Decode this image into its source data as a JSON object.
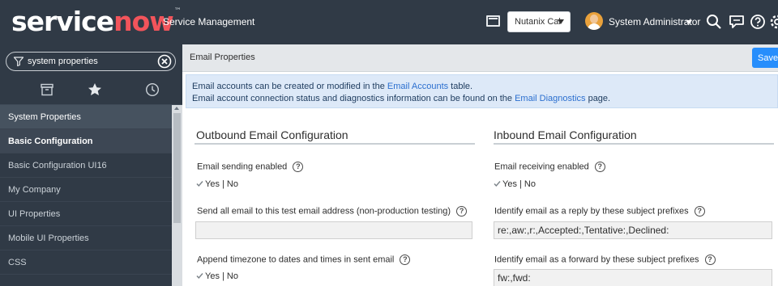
{
  "banner": {
    "logo_service": "service",
    "logo_now": "now",
    "logo_tm": "™",
    "app_name": "Service Management",
    "domain_select": "Nutanix Cal",
    "user_name": "System Administrator"
  },
  "nav": {
    "filter_value": "system properties",
    "items": [
      {
        "label": "System Properties"
      },
      {
        "label": "Basic Configuration"
      },
      {
        "label": "Basic Configuration UI16"
      },
      {
        "label": "My Company"
      },
      {
        "label": "UI Properties"
      },
      {
        "label": "Mobile UI Properties"
      },
      {
        "label": "CSS"
      }
    ]
  },
  "header": {
    "title": "Email Properties",
    "save_label": "Save"
  },
  "info": {
    "line1_before": "Email accounts can be created or modified in the ",
    "line1_link": "Email Accounts",
    "line1_after": " table.",
    "line2_before": "Email account connection status and diagnostics information can be found on the ",
    "line2_link": "Email Diagnostics",
    "line2_after": " page."
  },
  "outbound": {
    "title": "Outbound Email Configuration",
    "sending_label": "Email sending enabled",
    "sending_value": "Yes | No",
    "test_address_label": "Send all email to this test email address (non-production testing)",
    "test_address_value": "",
    "timezone_label": "Append timezone to dates and times in sent email",
    "timezone_value": "Yes | No"
  },
  "inbound": {
    "title": "Inbound Email Configuration",
    "receiving_label": "Email receiving enabled",
    "receiving_value": "Yes | No",
    "reply_prefix_label": "Identify email as a reply by these subject prefixes",
    "reply_prefix_value": "re:,aw:,r:,Accepted:,Tentative:,Declined:",
    "forward_prefix_label": "Identify email as a forward by these subject prefixes",
    "forward_prefix_value": "fw:,fwd:"
  },
  "icons": {
    "help": "?",
    "help_icon": "help-circle-icon",
    "check_icon": "checkbox-checked-icon",
    "search_icon": "search-icon",
    "chat_icon": "chat-icon",
    "settings_icon": "gear-icon",
    "filter_icon": "filter-icon",
    "clear_icon": "close-circle-icon",
    "archive_icon": "archive-icon",
    "star_icon": "star-icon",
    "history_icon": "clock-icon"
  },
  "colors": {
    "banner_bg": "#303a46",
    "logo_accent": "#f2545b",
    "save_button": "#278efc",
    "info_bg": "#dde9f8",
    "link": "#2b6fcf"
  }
}
